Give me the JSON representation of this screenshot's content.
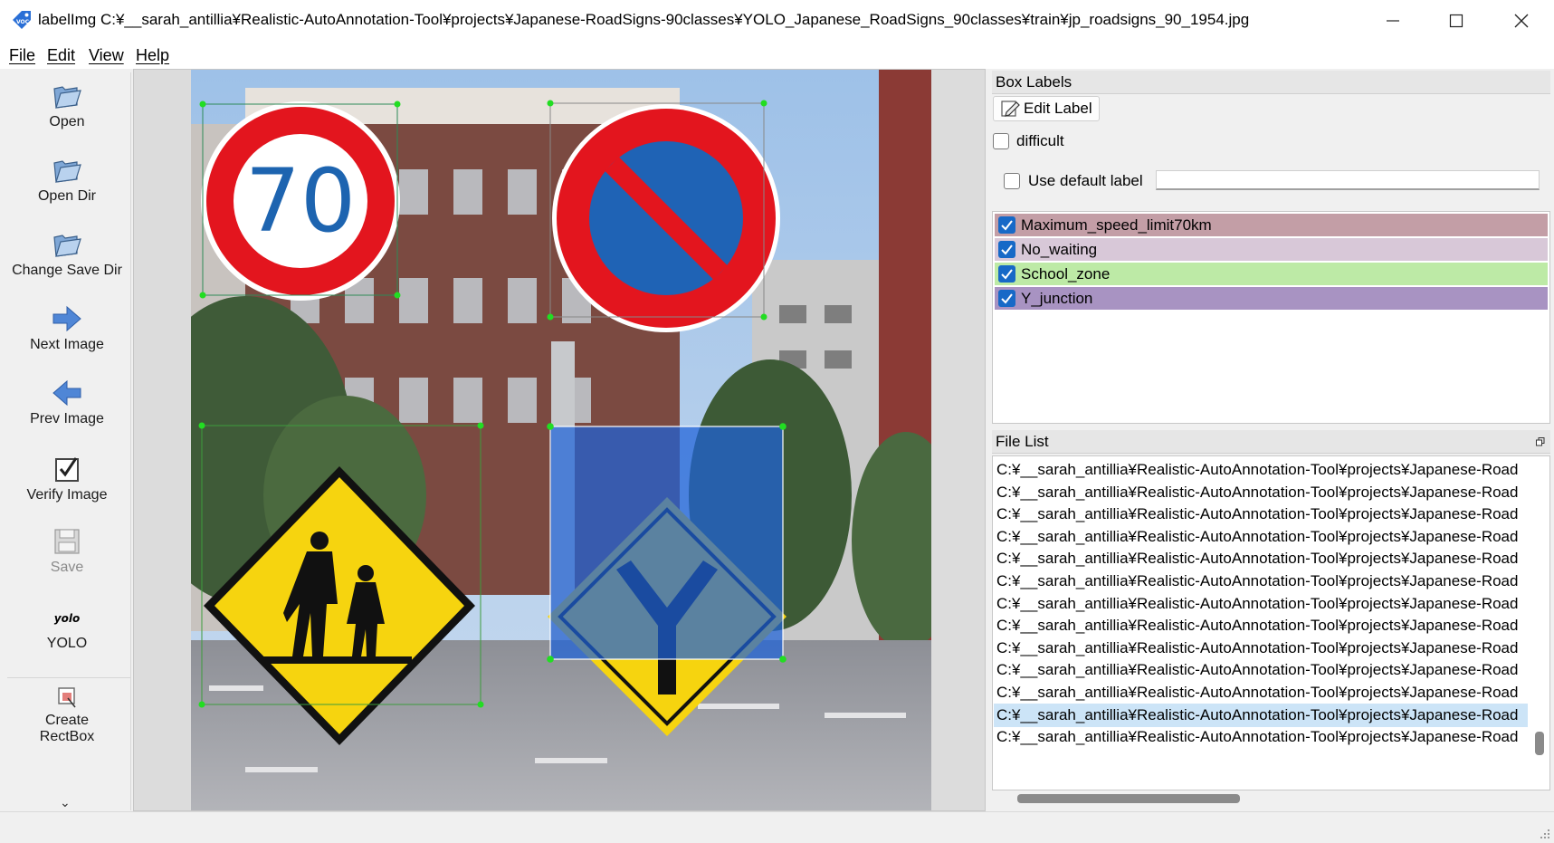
{
  "window": {
    "title": "labelImg C:¥__sarah_antillia¥Realistic-AutoAnnotation-Tool¥projects¥Japanese-RoadSigns-90classes¥YOLO_Japanese_RoadSigns_90classes¥train¥jp_roadsigns_90_1954.jpg",
    "icon": "labelimg-app-icon"
  },
  "menu": {
    "file": "File",
    "edit": "Edit",
    "view": "View",
    "help": "Help"
  },
  "toolbar": {
    "open": "Open",
    "open_dir": "Open Dir",
    "change_save_dir": "Change Save Dir",
    "next_image": "Next Image",
    "prev_image": "Prev Image",
    "verify_image": "Verify Image",
    "save": "Save",
    "yolo_icon_text": "yolo",
    "yolo": "YOLO",
    "create_rectbox": "Create\nRectBox"
  },
  "canvas": {
    "signs": {
      "speed_limit_text": "70"
    }
  },
  "box_labels": {
    "title": "Box Labels",
    "edit_label": "Edit Label",
    "difficult": "difficult",
    "use_default_label": "Use default label",
    "default_label_value": "",
    "items": [
      {
        "label": "Maximum_speed_limit70km",
        "checked": true,
        "color": "#c39ea6"
      },
      {
        "label": "No_waiting",
        "checked": true,
        "color": "#d8c8d8"
      },
      {
        "label": "School_zone",
        "checked": true,
        "color": "#bdeaa6"
      },
      {
        "label": "Y_junction",
        "checked": true,
        "color": "#a893c2"
      }
    ]
  },
  "file_list": {
    "title": "File List",
    "selected_index": 11,
    "items": [
      "C:¥__sarah_antillia¥Realistic-AutoAnnotation-Tool¥projects¥Japanese-Road",
      "C:¥__sarah_antillia¥Realistic-AutoAnnotation-Tool¥projects¥Japanese-Road",
      "C:¥__sarah_antillia¥Realistic-AutoAnnotation-Tool¥projects¥Japanese-Road",
      "C:¥__sarah_antillia¥Realistic-AutoAnnotation-Tool¥projects¥Japanese-Road",
      "C:¥__sarah_antillia¥Realistic-AutoAnnotation-Tool¥projects¥Japanese-Road",
      "C:¥__sarah_antillia¥Realistic-AutoAnnotation-Tool¥projects¥Japanese-Road",
      "C:¥__sarah_antillia¥Realistic-AutoAnnotation-Tool¥projects¥Japanese-Road",
      "C:¥__sarah_antillia¥Realistic-AutoAnnotation-Tool¥projects¥Japanese-Road",
      "C:¥__sarah_antillia¥Realistic-AutoAnnotation-Tool¥projects¥Japanese-Road",
      "C:¥__sarah_antillia¥Realistic-AutoAnnotation-Tool¥projects¥Japanese-Road",
      "C:¥__sarah_antillia¥Realistic-AutoAnnotation-Tool¥projects¥Japanese-Road",
      "C:¥__sarah_antillia¥Realistic-AutoAnnotation-Tool¥projects¥Japanese-Road",
      "C:¥__sarah_antillia¥Realistic-AutoAnnotation-Tool¥projects¥Japanese-Road"
    ]
  },
  "colors": {
    "accent": "#1769c7",
    "selection": "#cce4f7",
    "vertex": "#22dd22"
  }
}
